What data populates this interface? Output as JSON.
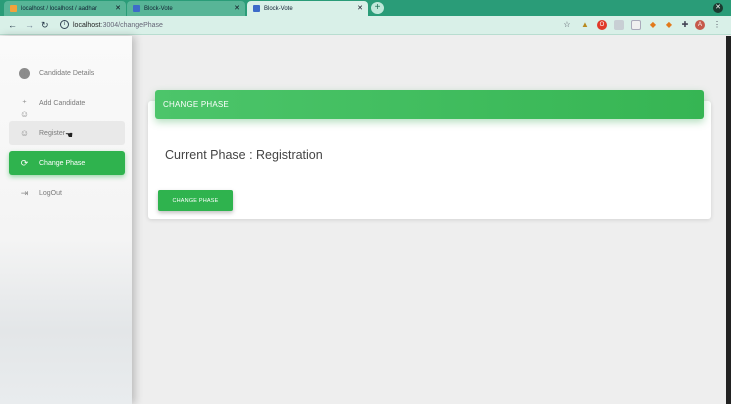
{
  "browser": {
    "tabs": [
      {
        "title": "localhost / localhost / aadhar"
      },
      {
        "title": "Block-Vote"
      },
      {
        "title": "Block-Vote",
        "active": true
      }
    ],
    "url_host": "localhost",
    "url_path": ":3004/changePhase",
    "icons": [
      "back-arrow",
      "forward-arrow",
      "reload",
      "site-info",
      "bookmark-star",
      "extensions"
    ]
  },
  "sidebar": {
    "items": [
      {
        "label": "Candidate Details",
        "icon": "info-icon"
      },
      {
        "label": "Add Candidate",
        "icon": "person-add-icon"
      },
      {
        "label": "Register",
        "icon": "person-icon"
      },
      {
        "label": "Change Phase",
        "icon": "refresh-icon",
        "active": true
      },
      {
        "label": "LogOut",
        "icon": "logout-icon"
      }
    ]
  },
  "main": {
    "card_title": "CHANGE PHASE",
    "current_phase": "Current Phase : Registration",
    "button_label": "CHANGE PHASE"
  },
  "colors": {
    "accent": "#2fb34e",
    "chrome": "#2a9c78",
    "chrome_light": "#d9f0e8"
  }
}
